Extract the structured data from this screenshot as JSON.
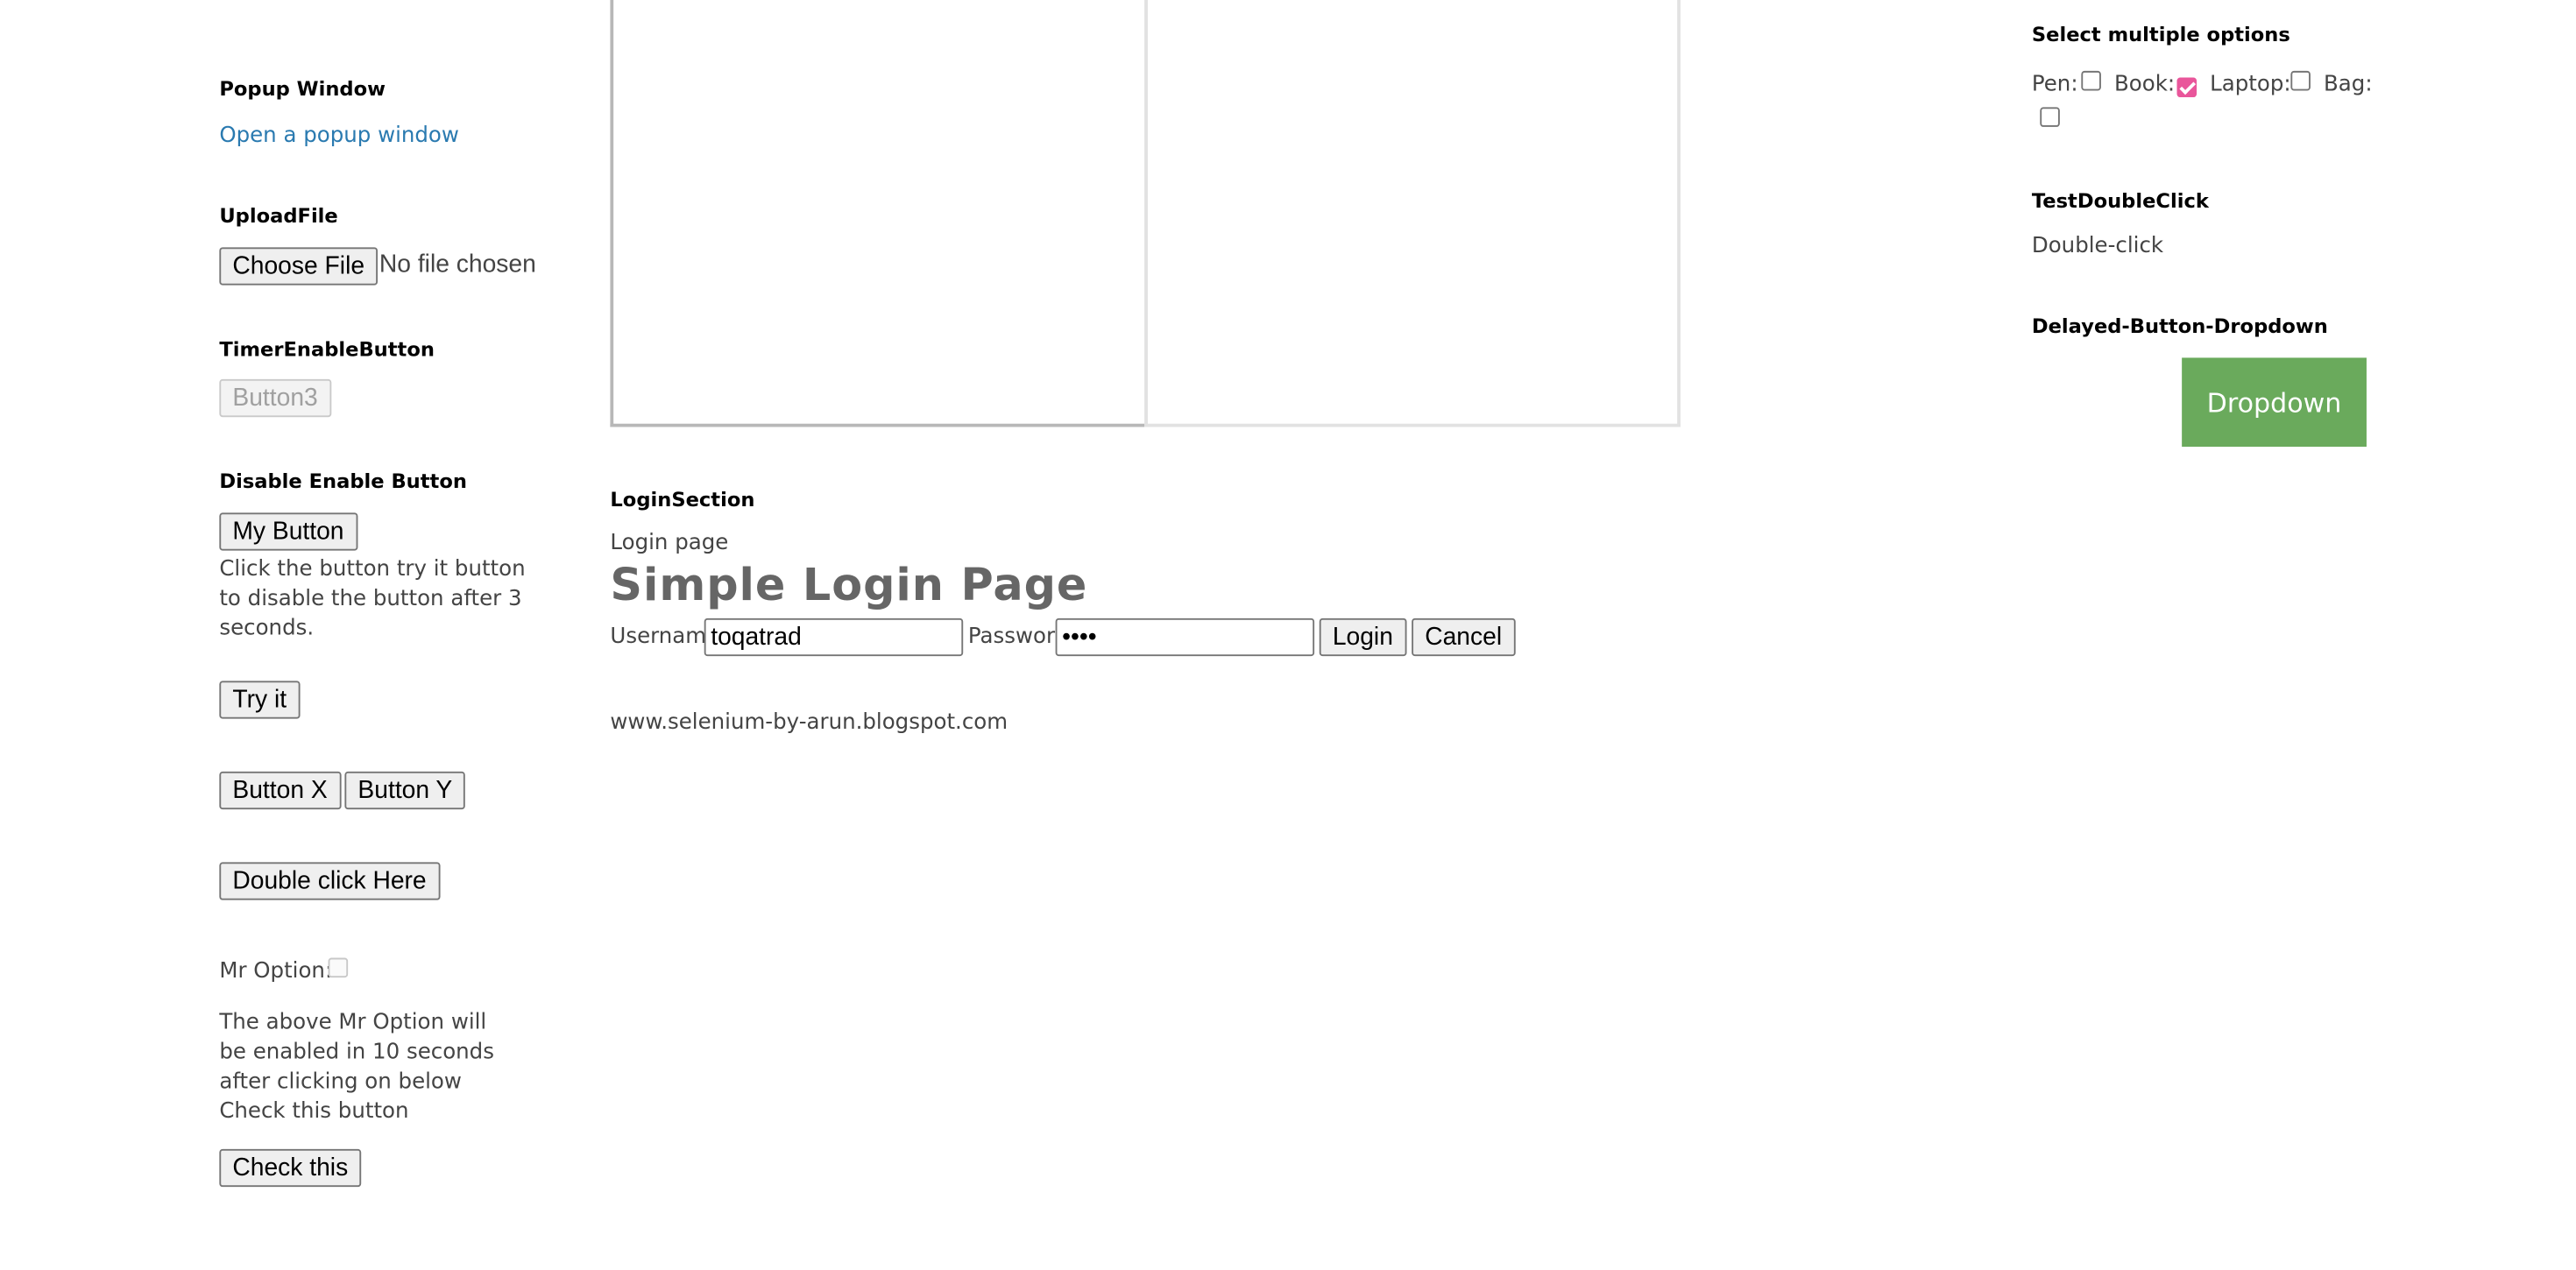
{
  "popup": {
    "title": "Popup Window",
    "link": "Open a popup window"
  },
  "upload": {
    "title": "UploadFile",
    "button": "Choose File",
    "status": "No file chosen"
  },
  "timer": {
    "title": "TimerEnableButton",
    "button": "Button3"
  },
  "disable_enable": {
    "title": "Disable Enable Button",
    "my_button": "My Button",
    "description": "Click the button try it button to disable the button after 3 seconds.",
    "try_it": "Try it"
  },
  "xy_buttons": {
    "x": "Button X",
    "y": "Button Y"
  },
  "double_click_button": "Double click Here",
  "mr_option": {
    "label": "Mr Option:",
    "description": "The above Mr Option will be enabled in 10 seconds after clicking on below Check this button",
    "check_button": "Check this"
  },
  "login": {
    "section_title": "LoginSection",
    "subtitle": "Login page",
    "page_title": "Simple Login Page",
    "username_label": "Username",
    "username_value": "toqatrad",
    "password_label": "Password",
    "password_value": "••••",
    "login_button": "Login",
    "cancel_button": "Cancel"
  },
  "footer_url": "www.selenium-by-arun.blogspot.com",
  "multiple_options": {
    "title": "Select multiple options",
    "options": [
      {
        "label": "Pen:",
        "checked": false
      },
      {
        "label": "Book:",
        "checked": true
      },
      {
        "label": "Laptop:",
        "checked": false
      },
      {
        "label": "Bag:",
        "checked": false
      }
    ]
  },
  "double_click_test": {
    "title": "TestDoubleClick",
    "text": "Double-click"
  },
  "delayed_dropdown": {
    "title": "Delayed-Button-Dropdown",
    "button": "Dropdown"
  },
  "colors": {
    "link": "#2a7ab0",
    "dropdown_bg": "#6aaa5c",
    "checkbox_checked": "#e9569b"
  }
}
